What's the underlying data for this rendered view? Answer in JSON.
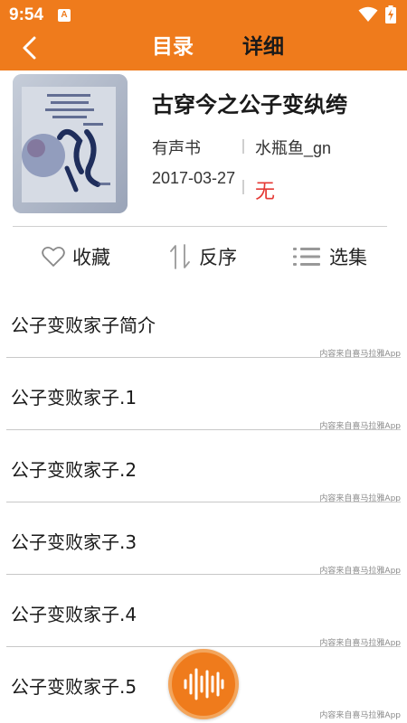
{
  "status_bar": {
    "time": "9:54",
    "notification_icon": "a-notification-icon",
    "wifi_icon": "wifi-icon",
    "battery_icon": "battery-charging-icon"
  },
  "header": {
    "back_icon": "back-arrow-icon",
    "tabs": [
      {
        "label": "目录"
      },
      {
        "label": "详细"
      }
    ],
    "background_color": "#ef7b1c"
  },
  "book": {
    "title": "古穿今之公子变纨绔",
    "type": "有声书",
    "author": "水瓶鱼_gn",
    "date": "2017-03-27",
    "status": "无"
  },
  "actions": {
    "favorite_label": "收藏",
    "reverse_label": "反序",
    "select_label": "选集"
  },
  "episodes": [
    {
      "title": "公子变败家子简介",
      "source": "内容来自喜马拉雅App"
    },
    {
      "title": "公子变败家子.1",
      "source": "内容来自喜马拉雅App"
    },
    {
      "title": "公子变败家子.2",
      "source": "内容来自喜马拉雅App"
    },
    {
      "title": "公子变败家子.3",
      "source": "内容来自喜马拉雅App"
    },
    {
      "title": "公子变败家子.4",
      "source": "内容来自喜马拉雅App"
    },
    {
      "title": "公子变败家子.5",
      "source": "内容来自喜马拉雅App"
    }
  ],
  "player": {
    "icon": "audio-wave-icon"
  }
}
